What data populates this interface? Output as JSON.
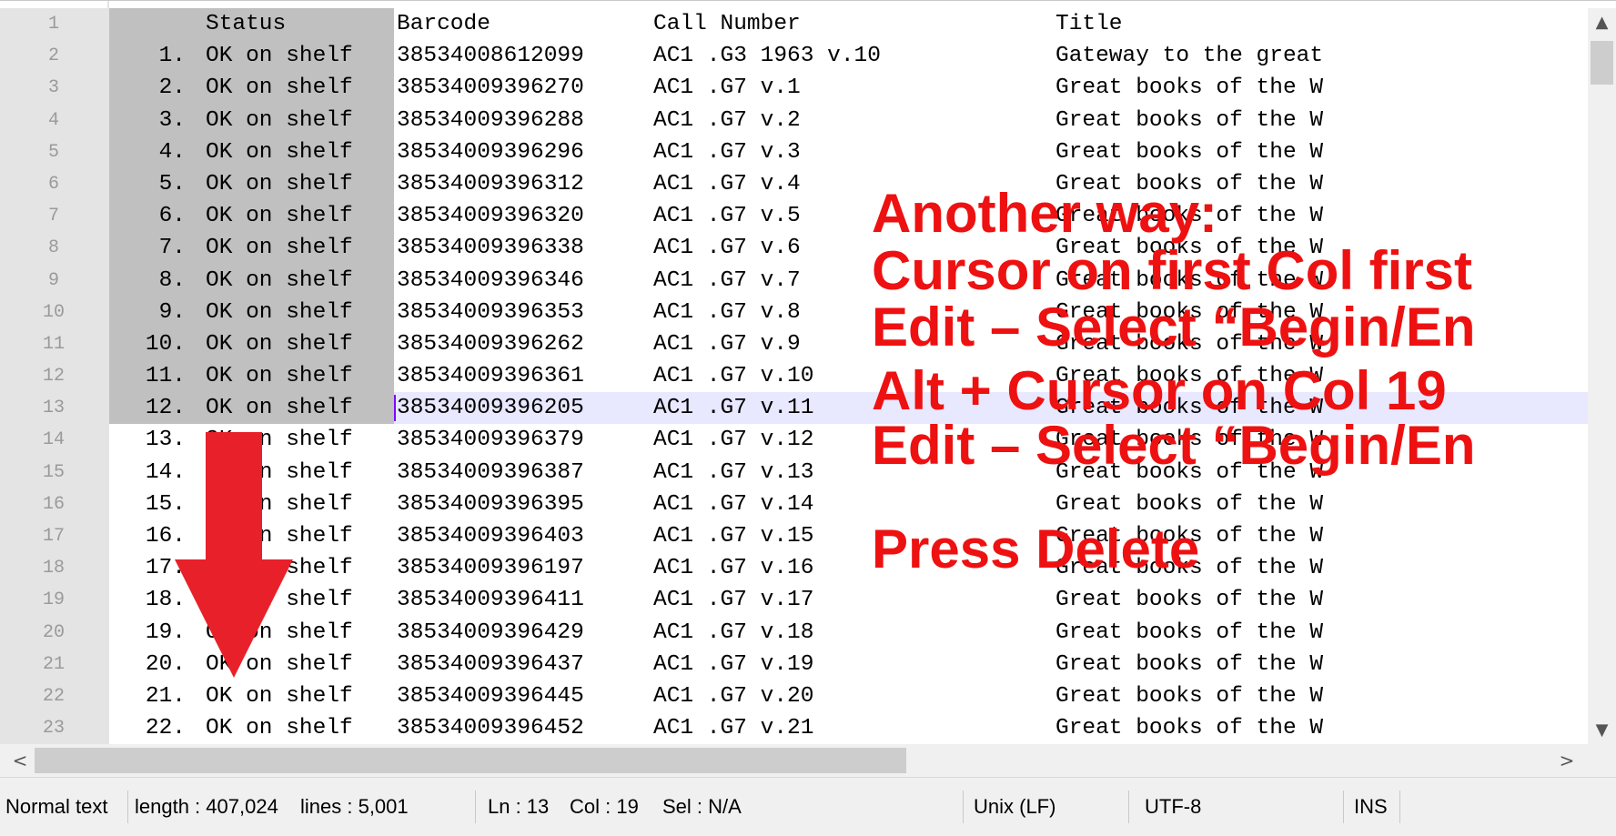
{
  "editor": {
    "columns": [
      "Status",
      "Barcode",
      "Call Number",
      "Title"
    ],
    "line_numbers": [
      "1",
      "2",
      "3",
      "4",
      "5",
      "6",
      "7",
      "8",
      "9",
      "10",
      "11",
      "12",
      "13",
      "14",
      "15",
      "16",
      "17",
      "18",
      "19",
      "20",
      "21",
      "22",
      "23"
    ],
    "rows": [
      {
        "num": "1.",
        "status": "OK on shelf",
        "barcode": "38534008612099",
        "call": "AC1 .G3 1963 v.10",
        "title": "Gateway to the great"
      },
      {
        "num": "2.",
        "status": "OK on shelf",
        "barcode": "38534009396270",
        "call": "AC1 .G7 v.1",
        "title": "Great books of the W"
      },
      {
        "num": "3.",
        "status": "OK on shelf",
        "barcode": "38534009396288",
        "call": "AC1 .G7 v.2",
        "title": "Great books of the W"
      },
      {
        "num": "4.",
        "status": "OK on shelf",
        "barcode": "38534009396296",
        "call": "AC1 .G7 v.3",
        "title": "Great books of the W"
      },
      {
        "num": "5.",
        "status": "OK on shelf",
        "barcode": "38534009396312",
        "call": "AC1 .G7 v.4",
        "title": "Great books of the W"
      },
      {
        "num": "6.",
        "status": "OK on shelf",
        "barcode": "38534009396320",
        "call": "AC1 .G7 v.5",
        "title": "Great books of the W"
      },
      {
        "num": "7.",
        "status": "OK on shelf",
        "barcode": "38534009396338",
        "call": "AC1 .G7 v.6",
        "title": "Great books of the W"
      },
      {
        "num": "8.",
        "status": "OK on shelf",
        "barcode": "38534009396346",
        "call": "AC1 .G7 v.7",
        "title": "Great books of the W"
      },
      {
        "num": "9.",
        "status": "OK on shelf",
        "barcode": "38534009396353",
        "call": "AC1 .G7 v.8",
        "title": "Great books of the W"
      },
      {
        "num": "10.",
        "status": "OK on shelf",
        "barcode": "38534009396262",
        "call": "AC1 .G7 v.9",
        "title": "Great books of the W"
      },
      {
        "num": "11.",
        "status": "OK on shelf",
        "barcode": "38534009396361",
        "call": "AC1 .G7 v.10",
        "title": "Great books of the W"
      },
      {
        "num": "12.",
        "status": "OK on shelf",
        "barcode": "38534009396205",
        "call": "AC1 .G7 v.11",
        "title": "Great books of the W"
      },
      {
        "num": "13.",
        "status": "OK on shelf",
        "barcode": "38534009396379",
        "call": "AC1 .G7 v.12",
        "title": "Great books of the W"
      },
      {
        "num": "14.",
        "status": "OK on shelf",
        "barcode": "38534009396387",
        "call": "AC1 .G7 v.13",
        "title": "Great books of the W"
      },
      {
        "num": "15.",
        "status": "OK on shelf",
        "barcode": "38534009396395",
        "call": "AC1 .G7 v.14",
        "title": "Great books of the W"
      },
      {
        "num": "16.",
        "status": "OK on shelf",
        "barcode": "38534009396403",
        "call": "AC1 .G7 v.15",
        "title": "Great books of the W"
      },
      {
        "num": "17.",
        "status": "OK on shelf",
        "barcode": "38534009396197",
        "call": "AC1 .G7 v.16",
        "title": "Great books of the W"
      },
      {
        "num": "18.",
        "status": "OK on shelf",
        "barcode": "38534009396411",
        "call": "AC1 .G7 v.17",
        "title": "Great books of the W"
      },
      {
        "num": "19.",
        "status": "OK on shelf",
        "barcode": "38534009396429",
        "call": "AC1 .G7 v.18",
        "title": "Great books of the W"
      },
      {
        "num": "20.",
        "status": "OK on shelf",
        "barcode": "38534009396437",
        "call": "AC1 .G7 v.19",
        "title": "Great books of the W"
      },
      {
        "num": "21.",
        "status": "OK on shelf",
        "barcode": "38534009396445",
        "call": "AC1 .G7 v.20",
        "title": "Great books of the W"
      },
      {
        "num": "22.",
        "status": "OK on shelf",
        "barcode": "38534009396452",
        "call": "AC1 .G7 v.21",
        "title": "Great books of the W"
      }
    ]
  },
  "overlay": {
    "lines": [
      "Another way:",
      "Cursor on first Col first",
      "Edit – Select “Begin/En",
      "Alt + Cursor on  Col 19",
      "Edit – Select “Begin/En",
      "Press Delete"
    ],
    "color": "#ee1111"
  },
  "scrollbars": {
    "up_icon": "▲",
    "down_icon": "▼",
    "left_icon": "<",
    "right_icon": ">"
  },
  "statusbar": {
    "mode": "Normal text",
    "length": "length : 407,024",
    "lines": "lines : 5,001",
    "ln": "Ln : 13",
    "col": "Col : 19",
    "sel": "Sel : N/A",
    "eol": "Unix (LF)",
    "encoding": "UTF-8",
    "ins": "INS"
  },
  "colors": {
    "selection": "#c0c0c0",
    "current_line": "#e8e8ff",
    "caret": "#8000ff",
    "arrow": "#e8202a"
  }
}
